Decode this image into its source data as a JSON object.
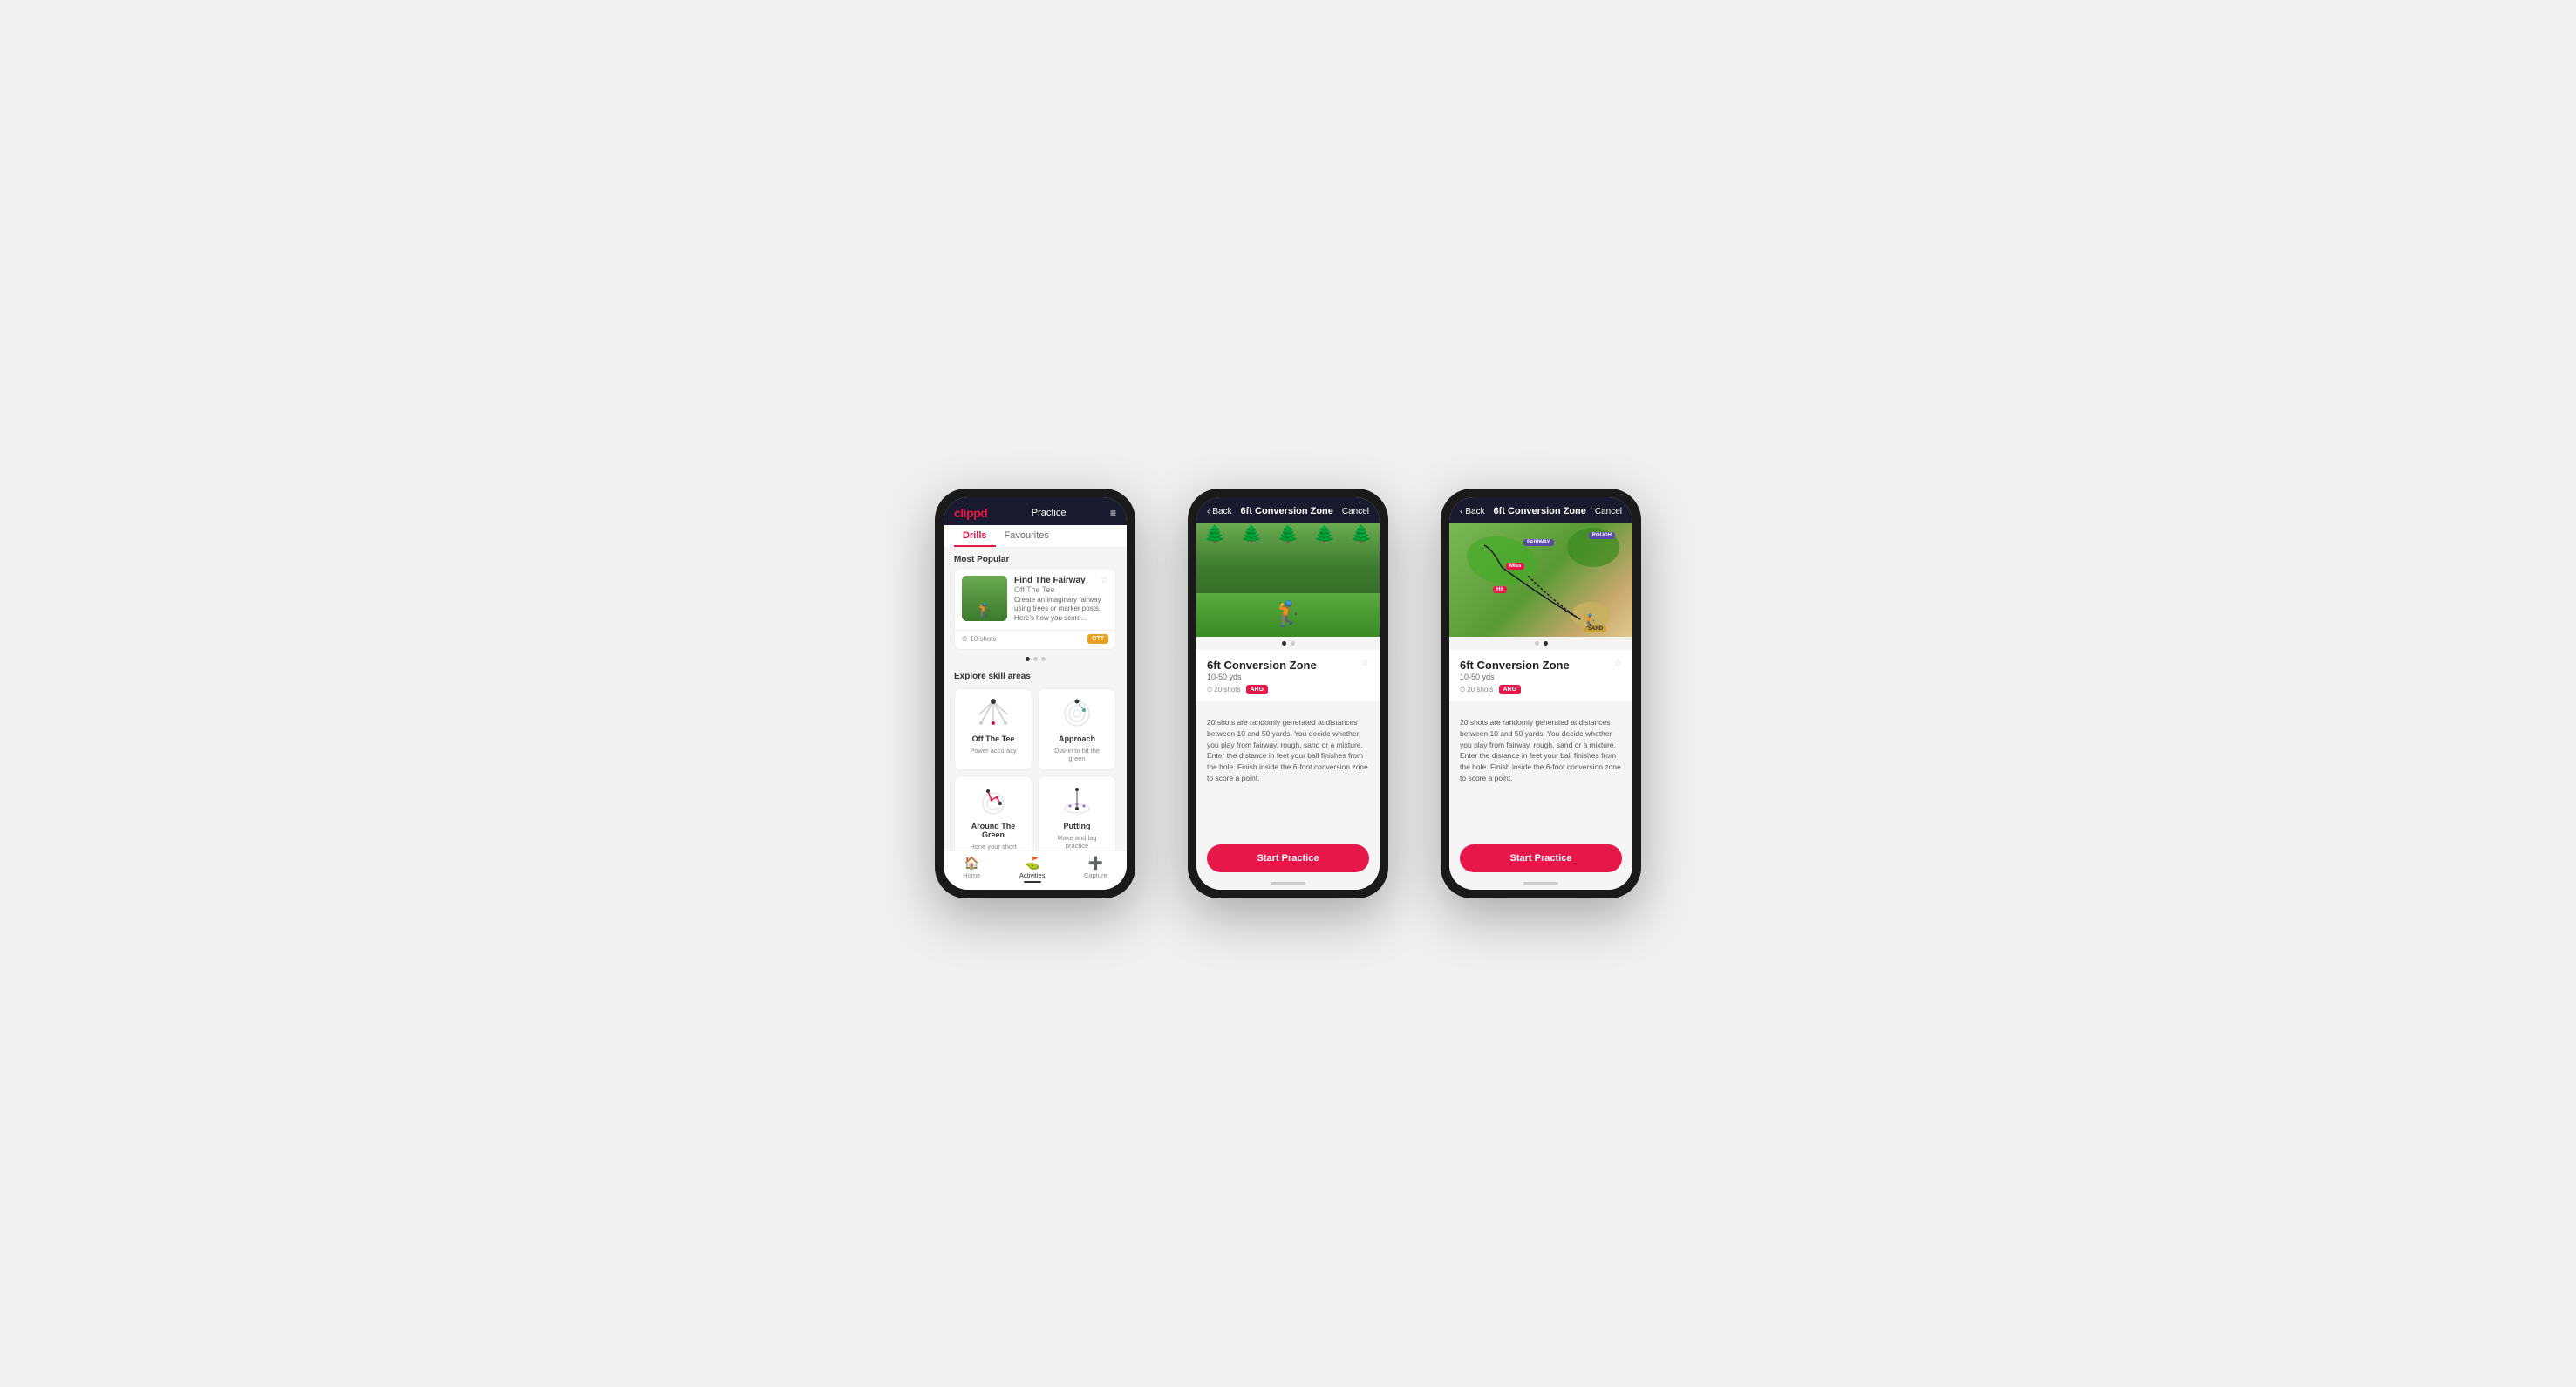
{
  "app": {
    "logo": "clippd",
    "nav_title": "Practice",
    "hamburger": "≡"
  },
  "phone1": {
    "tabs": [
      {
        "label": "Drills",
        "active": true
      },
      {
        "label": "Favourites",
        "active": false
      }
    ],
    "most_popular_label": "Most Popular",
    "featured_drill": {
      "title": "Find The Fairway",
      "subtitle": "Off The Tee",
      "description": "Create an imaginary fairway using trees or marker posts. Here's how you score...",
      "shots": "10 shots",
      "badge": "OTT"
    },
    "explore_label": "Explore skill areas",
    "skills": [
      {
        "name": "Off The Tee",
        "desc": "Power accuracy"
      },
      {
        "name": "Approach",
        "desc": "Dial-in to hit the green"
      },
      {
        "name": "Around The Green",
        "desc": "Hone your short game"
      },
      {
        "name": "Putting",
        "desc": "Make and lag practice"
      }
    ],
    "nav": [
      {
        "icon": "🏠",
        "label": "Home",
        "active": false
      },
      {
        "icon": "⛳",
        "label": "Activities",
        "active": true
      },
      {
        "icon": "➕",
        "label": "Capture",
        "active": false
      }
    ]
  },
  "phone2": {
    "back_label": "Back",
    "header_title": "6ft Conversion Zone",
    "cancel_label": "Cancel",
    "drill_title": "6ft Conversion Zone",
    "drill_range": "10-50 yds",
    "shots": "20 shots",
    "badge": "ARG",
    "description": "20 shots are randomly generated at distances between 10 and 50 yards. You decide whether you play from fairway, rough, sand or a mixture. Enter the distance in feet your ball finishes from the hole. Finish inside the 6-foot conversion zone to score a point.",
    "start_btn": "Start Practice"
  },
  "phone3": {
    "back_label": "Back",
    "header_title": "6ft Conversion Zone",
    "cancel_label": "Cancel",
    "drill_title": "6ft Conversion Zone",
    "drill_range": "10-50 yds",
    "shots": "20 shots",
    "badge": "ARG",
    "description": "20 shots are randomly generated at distances between 10 and 50 yards. You decide whether you play from fairway, rough, sand or a mixture. Enter the distance in feet your ball finishes from the hole. Finish inside the 6-foot conversion zone to score a point.",
    "start_btn": "Start Practice",
    "map_labels": {
      "fairway": "FAIRWAY",
      "rough": "ROUGH",
      "miss": "Miss",
      "hit": "Hit",
      "sand": "SAND"
    }
  }
}
